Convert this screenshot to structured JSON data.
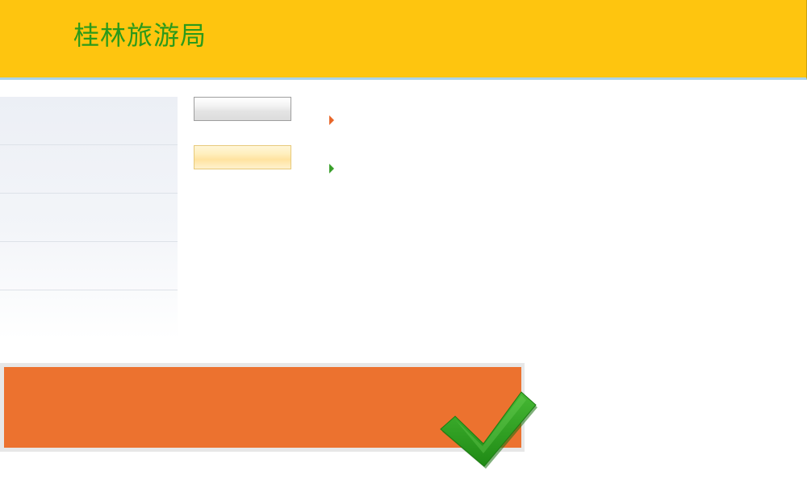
{
  "header": {
    "title": "桂林旅游局",
    "background_color": "#fec50f",
    "title_color": "#2b9a1a"
  },
  "side_menu": {
    "items": [
      "",
      "",
      "",
      "",
      ""
    ]
  },
  "buttons": {
    "gray_label": "",
    "yellow_label": ""
  },
  "arrows": {
    "orange_color": "#e8672a",
    "green_color": "#3a9f2b"
  },
  "banner": {
    "color": "#ec722f",
    "icon": "checkmark-icon",
    "icon_color": "#2a9a1c"
  }
}
